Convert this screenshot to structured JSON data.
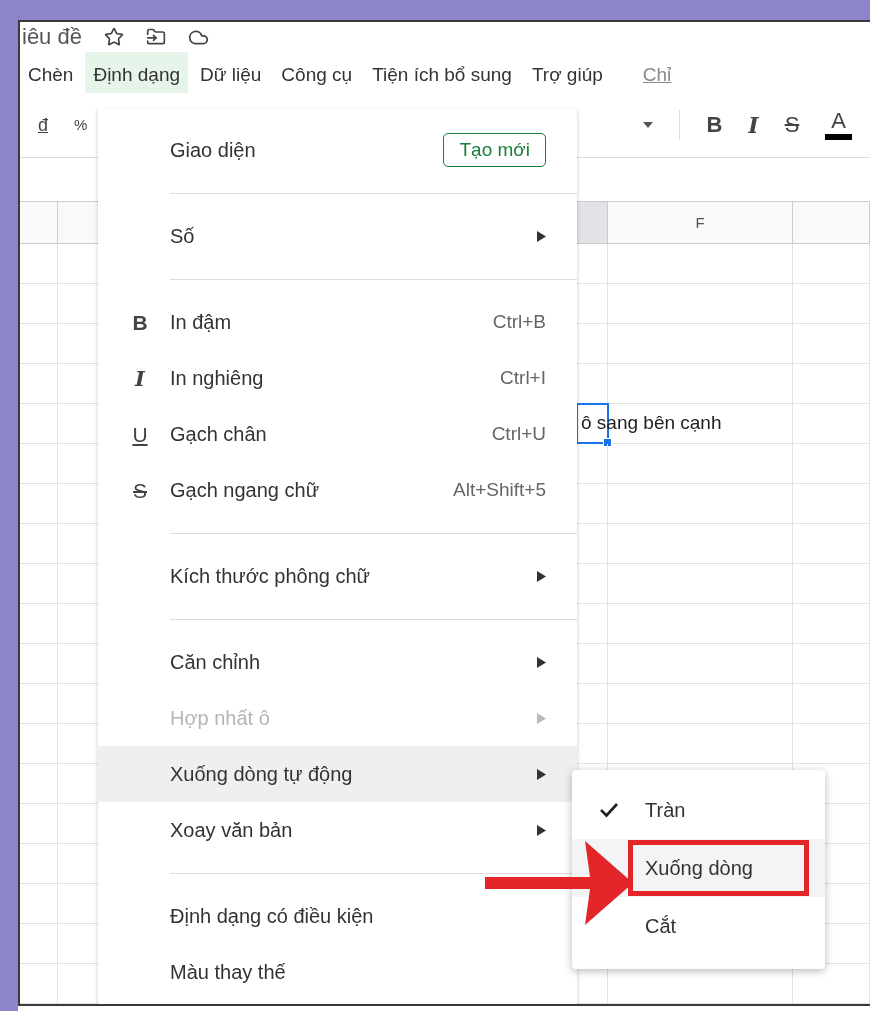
{
  "document": {
    "title": "iêu đề"
  },
  "menubar": [
    {
      "label": "Chèn",
      "kind": "menu",
      "selected": false
    },
    {
      "label": "Định dạng",
      "kind": "menu",
      "selected": true
    },
    {
      "label": "Dữ liệu",
      "kind": "menu",
      "selected": false
    },
    {
      "label": "Công cụ",
      "kind": "menu",
      "selected": false
    },
    {
      "label": "Tiện ích bổ sung",
      "kind": "menu",
      "selected": false
    },
    {
      "label": "Trợ giúp",
      "kind": "menu",
      "selected": false
    },
    {
      "label": "Chỉ",
      "kind": "link",
      "selected": false
    }
  ],
  "toolbar": {
    "left": [
      {
        "text": "đ",
        "kind": "currency"
      },
      {
        "text": "%",
        "kind": "percent"
      }
    ],
    "right": [
      {
        "text": "B",
        "kind": "bold"
      },
      {
        "text": "I",
        "kind": "italic"
      },
      {
        "text": "S",
        "kind": "strike"
      },
      {
        "text": "A",
        "kind": "color"
      }
    ]
  },
  "sheet": {
    "column_header": "F",
    "active_cell": "ô sang bên cạnh"
  },
  "menu": [
    {
      "kind": "button",
      "label": "Giao diện",
      "button": "Tạo mới",
      "disabled": false,
      "selected": false
    },
    {
      "kind": "divider"
    },
    {
      "kind": "submenu",
      "label": "Số",
      "disabled": false,
      "selected": false
    },
    {
      "kind": "divider"
    },
    {
      "kind": "shortcut",
      "icon": "B",
      "label": "In đậm",
      "shortcut": "Ctrl+B",
      "disabled": false,
      "selected": false
    },
    {
      "kind": "shortcut",
      "icon": "I",
      "label": "In nghiêng",
      "shortcut": "Ctrl+I",
      "disabled": false,
      "selected": false
    },
    {
      "kind": "shortcut",
      "icon": "U",
      "label": "Gạch chân",
      "shortcut": "Ctrl+U",
      "disabled": false,
      "selected": false
    },
    {
      "kind": "shortcut",
      "icon": "S",
      "label": "Gạch ngang chữ",
      "shortcut": "Alt+Shift+5",
      "disabled": false,
      "selected": false
    },
    {
      "kind": "divider"
    },
    {
      "kind": "submenu",
      "label": "Kích thước phông chữ",
      "disabled": false,
      "selected": false
    },
    {
      "kind": "divider"
    },
    {
      "kind": "submenu",
      "label": "Căn chỉnh",
      "disabled": false,
      "selected": false
    },
    {
      "kind": "submenu",
      "label": "Hợp nhất ô",
      "disabled": true,
      "selected": false
    },
    {
      "kind": "submenu",
      "label": "Xuống dòng tự động",
      "disabled": false,
      "selected": true
    },
    {
      "kind": "submenu",
      "label": "Xoay văn bản",
      "disabled": false,
      "selected": false
    },
    {
      "kind": "divider"
    },
    {
      "kind": "plain",
      "label": "Định dạng có điều kiện",
      "disabled": false,
      "selected": false
    },
    {
      "kind": "plain",
      "label": "Màu thay thế",
      "disabled": false,
      "selected": false
    }
  ],
  "submenu": [
    {
      "label": "Tràn",
      "checked": true,
      "highlighted": false
    },
    {
      "label": "Xuống dòng",
      "checked": false,
      "highlighted": true
    },
    {
      "label": "Cắt",
      "checked": false,
      "highlighted": false
    }
  ]
}
